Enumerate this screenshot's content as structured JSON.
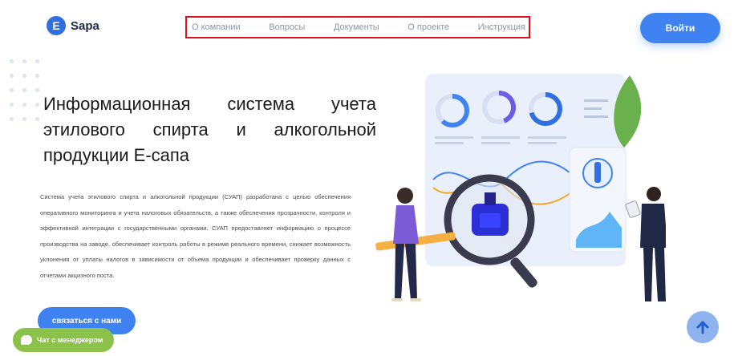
{
  "logo": {
    "letter": "E",
    "name": "Sapa"
  },
  "nav": {
    "items": [
      {
        "label": "О компании"
      },
      {
        "label": "Вопросы"
      },
      {
        "label": "Документы"
      },
      {
        "label": "О проекте"
      },
      {
        "label": "Инструкция"
      }
    ]
  },
  "header": {
    "login_label": "Войти"
  },
  "hero": {
    "title": "Информационная система учета этилового спирта и алкогольной продукции Е-сапа",
    "description": "Система учета этилового спирта и алкогольной продукции (СУАП) разработана с целью обеспечения оперативного мониторинга и учета налоговых обязательств, а также обеспечения прозрачности, контроля и эффективной интеграции с государственными органами. СУАП предоставляет информацию о процессе производства на заводе, обеспечивает контроль работы в режиме реального времени, снижает возможность уклонения от уплаты налогов в зависимости от объема продукции и обеспечивает проверку данных с отчетами акцизного поста.",
    "contact_label": "связаться с нами"
  },
  "chat": {
    "label": "Чат с менеджером"
  },
  "colors": {
    "primary": "#3f83f2",
    "chat": "#8bc34a",
    "nav_border": "#e01020"
  }
}
